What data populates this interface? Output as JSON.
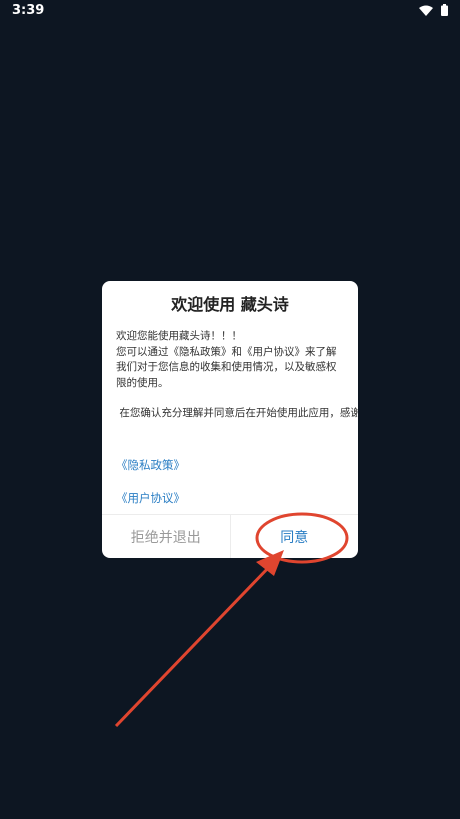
{
  "status_bar": {
    "time": "3:39",
    "icons": [
      "wifi-icon",
      "battery-icon"
    ]
  },
  "dialog": {
    "title": "欢迎使用 藏头诗",
    "body_para1": "欢迎您能使用藏头诗！！！\n您可以通过《隐私政策》和《用户协议》来了解我们对于您信息的收集和使用情况，以及敏感权限的使用。",
    "body_para2": " 在您确认充分理解并同意后在开始使用此应用，感谢！",
    "link_privacy": "《隐私政策》",
    "link_agreement": "《用户协议》",
    "decline_label": "拒绝并退出",
    "agree_label": "同意"
  },
  "colors": {
    "background": "#0d1622",
    "link": "#2a7ec4",
    "annotation": "#e0452f"
  }
}
